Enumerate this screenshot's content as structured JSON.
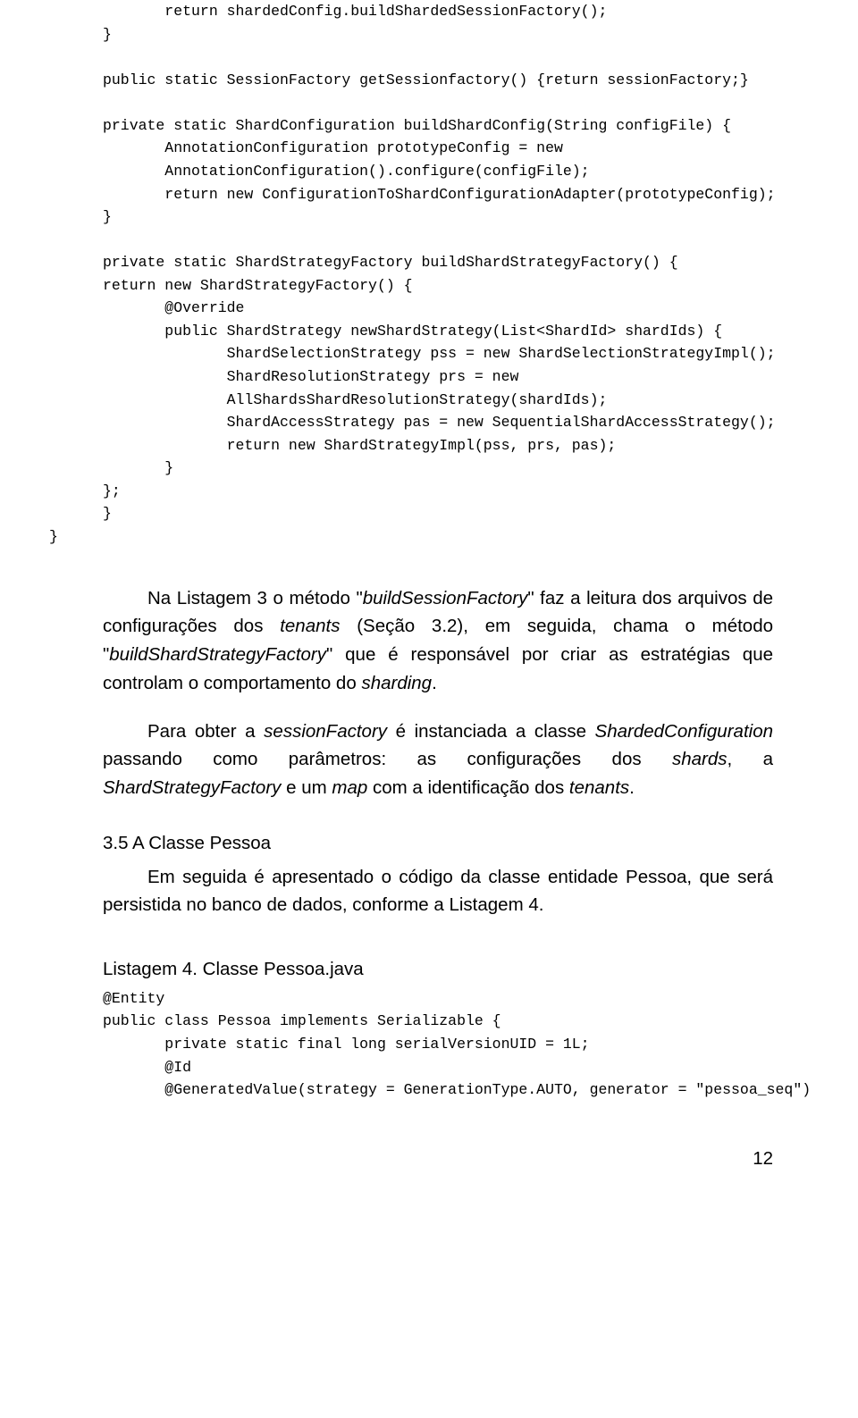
{
  "code1": {
    "l1": "       return shardedConfig.buildShardedSessionFactory();",
    "l2": "}",
    "l3": "",
    "l4": "public static SessionFactory getSessionfactory() {return sessionFactory;}",
    "l5": "",
    "l6": "private static ShardConfiguration buildShardConfig(String configFile) {",
    "l7": "       AnnotationConfiguration prototypeConfig = new",
    "l8": "       AnnotationConfiguration().configure(configFile);",
    "l9": "       return new ConfigurationToShardConfigurationAdapter(prototypeConfig);",
    "l10": "}",
    "l11": "",
    "l12": "private static ShardStrategyFactory buildShardStrategyFactory() {",
    "l13": "return new ShardStrategyFactory() {",
    "l14": "       @Override",
    "l15": "       public ShardStrategy newShardStrategy(List<ShardId> shardIds) {",
    "l16": "              ShardSelectionStrategy pss = new ShardSelectionStrategyImpl();",
    "l17": "              ShardResolutionStrategy prs = new",
    "l18": "              AllShardsShardResolutionStrategy(shardIds);",
    "l19": "              ShardAccessStrategy pas = new SequentialShardAccessStrategy();",
    "l20": "              return new ShardStrategyImpl(pss, prs, pas);",
    "l21": "       }",
    "l22": "};",
    "l23": "}",
    "l24": "}"
  },
  "p1": {
    "a": "Na Listagem 3 o método \"",
    "b": "buildSessionFactory",
    "c": "\" faz a leitura dos arquivos de configurações dos ",
    "d": "tenants",
    "e": " (Seção 3.2), em seguida, chama o método \"",
    "f": "buildShardStrategyFactory",
    "g": "\" que é responsável por criar as estratégias que controlam o comportamento do ",
    "h": "sharding",
    "i": "."
  },
  "p2": {
    "a": "Para obter a ",
    "b": "sessionFactory",
    "c": " é instanciada a classe ",
    "d": "ShardedConfiguration",
    "e": " passando como parâmetros: as configurações dos ",
    "f": "shards",
    "g": ", a ",
    "h": "ShardStrategyFactory",
    "i": " e um ",
    "j": "map",
    "k": " com a identificação dos ",
    "l": "tenants",
    "m": "."
  },
  "secTitle": "3.5 A Classe Pessoa",
  "p3": "Em seguida é apresentado o código da classe entidade Pessoa, que será persistida no banco de dados, conforme a Listagem 4.",
  "listingTitle": "Listagem 4. Classe Pessoa.java",
  "code2": {
    "l1": "@Entity",
    "l2": "public class Pessoa implements Serializable {",
    "l3": "       private static final long serialVersionUID = 1L;",
    "l4": "       @Id",
    "l5": "       @GeneratedValue(strategy = GenerationType.AUTO, generator = \"pessoa_seq\")"
  },
  "pageNumber": "12"
}
